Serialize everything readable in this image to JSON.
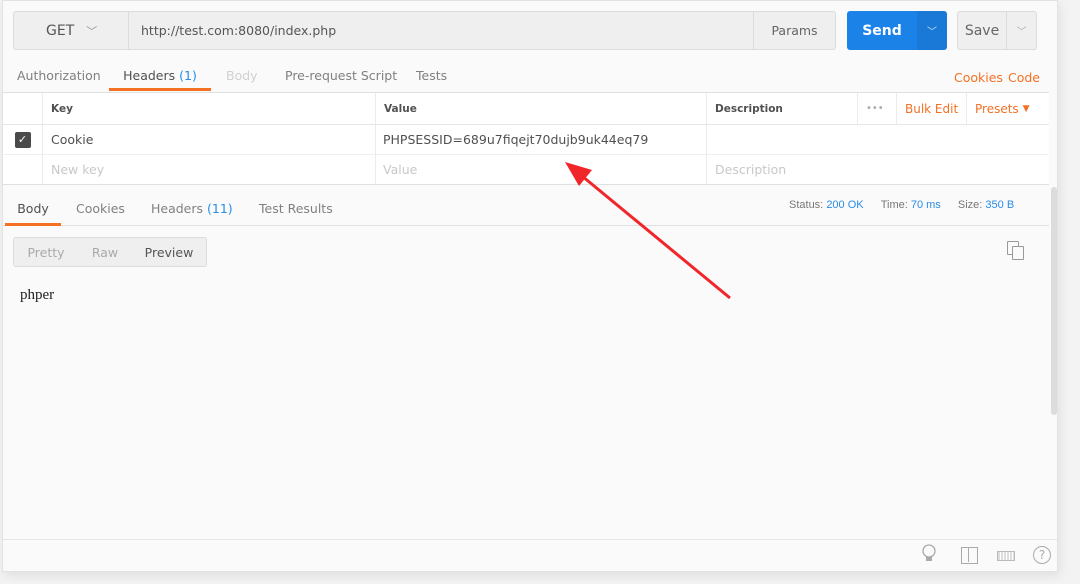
{
  "request": {
    "method": "GET",
    "url": "http://test.com:8080/index.php",
    "params_label": "Params",
    "send_label": "Send",
    "save_label": "Save"
  },
  "request_tabs": [
    {
      "label": "Authorization"
    },
    {
      "label": "Headers",
      "count": "(1)",
      "active": true
    },
    {
      "label": "Body",
      "disabled": true
    },
    {
      "label": "Pre-request Script"
    },
    {
      "label": "Tests"
    }
  ],
  "links": {
    "cookies": "Cookies",
    "code": "Code"
  },
  "headers_table": {
    "columns": {
      "key": "Key",
      "value": "Value",
      "description": "Description"
    },
    "more": "•••",
    "bulk_edit": "Bulk Edit",
    "presets": "Presets",
    "rows": [
      {
        "checked": true,
        "key": "Cookie",
        "value": "PHPSESSID=689u7fiqejt70dujb9uk44eq79",
        "description": ""
      }
    ],
    "placeholders": {
      "key": "New key",
      "value": "Value",
      "description": "Description"
    }
  },
  "response_tabs": [
    {
      "label": "Body",
      "active": true
    },
    {
      "label": "Cookies"
    },
    {
      "label": "Headers",
      "count": "(11)"
    },
    {
      "label": "Test Results"
    }
  ],
  "status": {
    "status_label": "Status:",
    "status_value": "200 OK",
    "time_label": "Time:",
    "time_value": "70 ms",
    "size_label": "Size:",
    "size_value": "350 B"
  },
  "view_modes": [
    "Pretty",
    "Raw",
    "Preview"
  ],
  "active_view": "Preview",
  "response_body": "phper",
  "colors": {
    "accent": "#f47023",
    "send": "#1b82e8",
    "link": "#2a8ce8",
    "arrow": "#f0262a"
  },
  "footer_icons": [
    "lightbulb-icon",
    "two-pane-icon",
    "keyboard-icon",
    "help-icon"
  ]
}
